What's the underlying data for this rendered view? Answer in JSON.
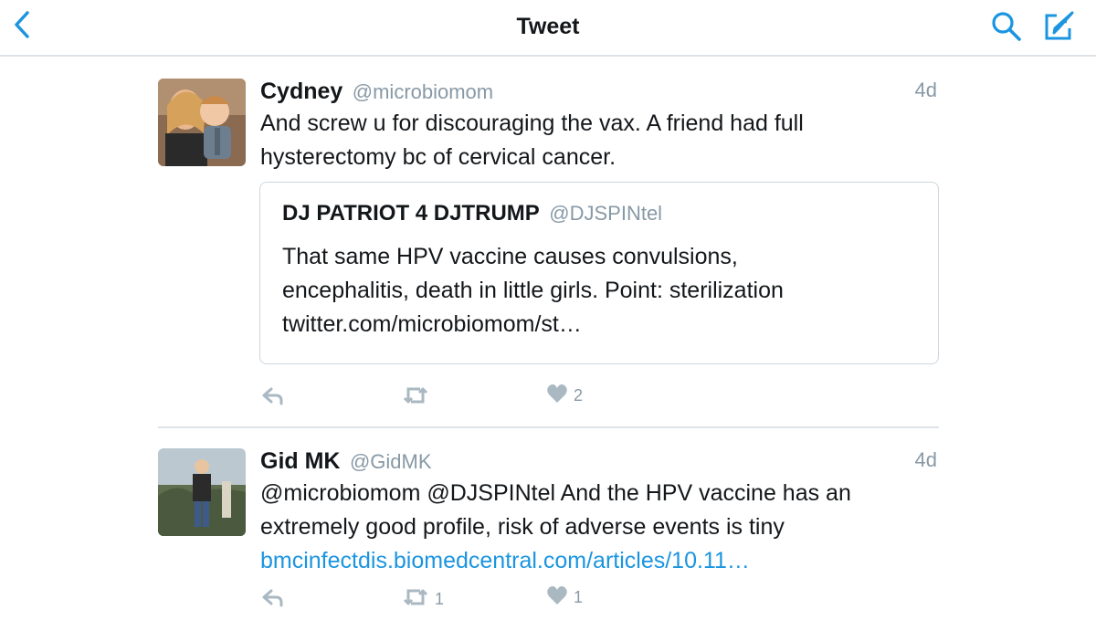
{
  "navbar": {
    "title": "Tweet",
    "back_icon": "chevron-left-icon",
    "search_icon": "search-icon",
    "compose_icon": "compose-icon",
    "accent_color": "#1b95e0"
  },
  "tweets": [
    {
      "name": "Cydney",
      "handle": "@microbiomom",
      "time": "4d",
      "text_lines": [
        "And screw u for discouraging the vax. A friend had full",
        "hysterectomy bc of cervical cancer."
      ],
      "quote": {
        "name": "DJ PATRIOT 4 DJTRUMP",
        "handle": "@DJSPINtel",
        "text_lines": [
          "That same HPV vaccine causes convulsions,",
          "encephalitis, death in little girls. Point: sterilization",
          "twitter.com/microbiomom/st…"
        ]
      },
      "actions": {
        "reply_count": "",
        "retweet_count": "",
        "like_count": "2"
      }
    },
    {
      "name": "Gid MK",
      "handle": "@GidMK",
      "time": "4d",
      "text_lines": [
        "@microbiomom @DJSPINtel And the HPV vaccine has an",
        "extremely good profile, risk of adverse events is tiny"
      ],
      "link": "bmcinfectdis.biomedcentral.com/articles/10.11…",
      "actions": {
        "reply_count": "",
        "retweet_count": "1",
        "like_count": "1"
      }
    }
  ]
}
